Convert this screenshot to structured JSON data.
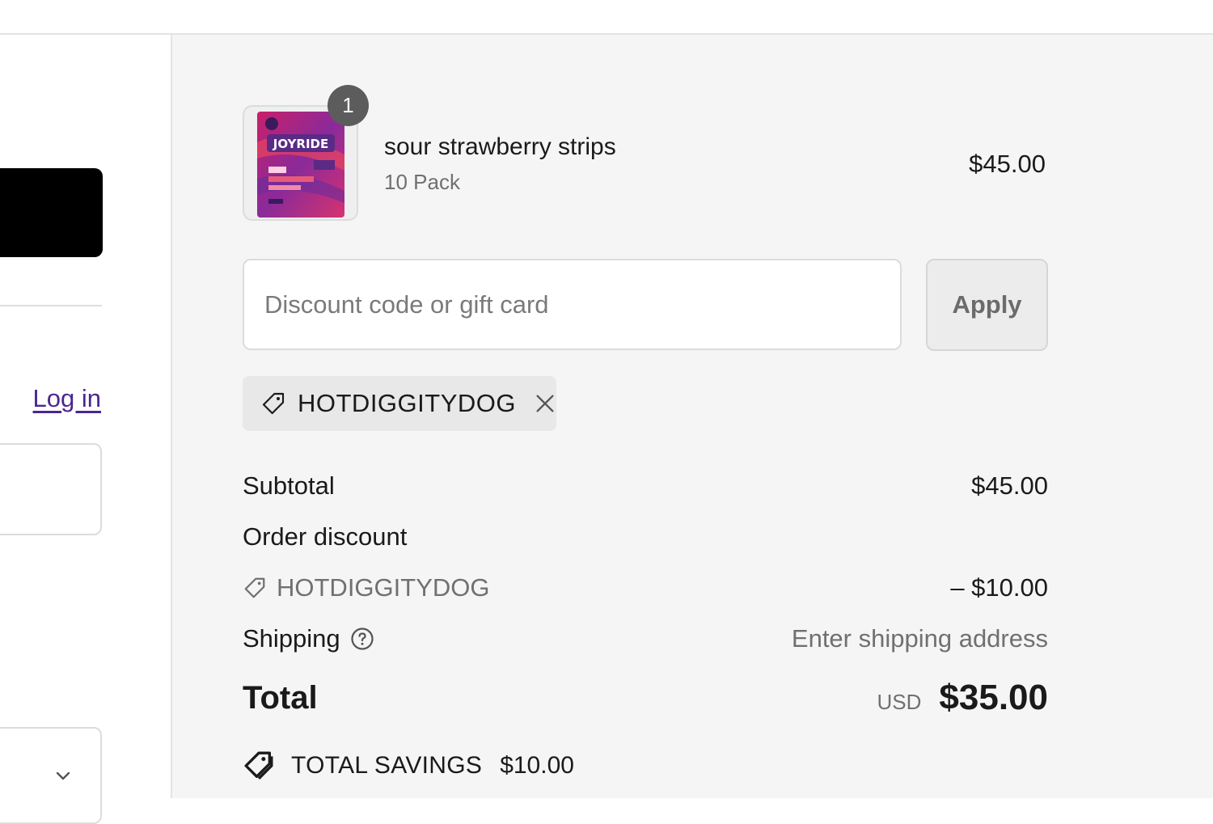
{
  "left": {
    "login_label": "Log in"
  },
  "product": {
    "name": "sour strawberry strips",
    "variant": "10 Pack",
    "price": "$45.00",
    "quantity": "1",
    "brand_text": "JOYRIDE"
  },
  "discount": {
    "placeholder": "Discount code or gift card",
    "value": "",
    "apply_label": "Apply",
    "applied_code": "HOTDIGGITYDOG"
  },
  "summary": {
    "subtotal_label": "Subtotal",
    "subtotal_value": "$45.00",
    "order_discount_label": "Order discount",
    "discount_code": "HOTDIGGITYDOG",
    "discount_value": "– $10.00",
    "shipping_label": "Shipping",
    "shipping_value": "Enter shipping address",
    "total_label": "Total",
    "currency": "USD",
    "total_value": "$35.00",
    "savings_label": "TOTAL SAVINGS",
    "savings_value": "$10.00"
  },
  "icons": {
    "tag": "tag-icon",
    "close": "close-icon",
    "help": "help-circle-icon",
    "tags": "tags-icon",
    "chevron": "chevron-down-icon"
  },
  "colors": {
    "link": "#4b2690",
    "panel_bg": "#f5f5f5",
    "badge_bg": "#5c5c5c"
  }
}
